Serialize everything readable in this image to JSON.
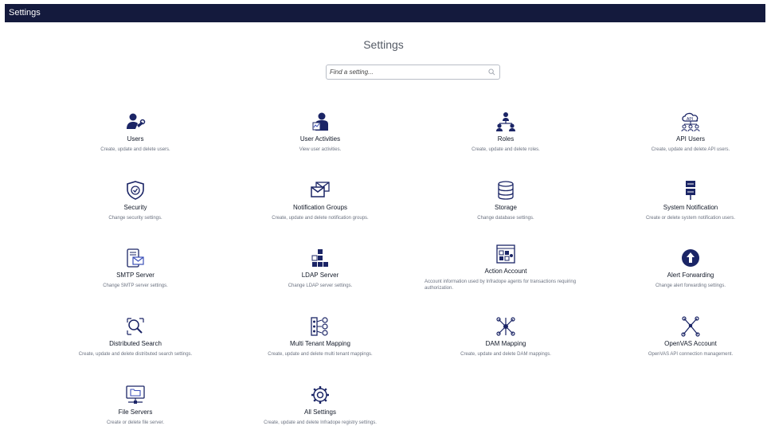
{
  "app": {
    "title": "Settings"
  },
  "page": {
    "heading": "Settings"
  },
  "search": {
    "placeholder": "Find a setting..."
  },
  "colors": {
    "topbar": "#141a3d",
    "icon": "#1b2566",
    "accent": "#3b4fb8"
  },
  "tiles": [
    {
      "id": "users",
      "icon": "user-wrench-icon",
      "name": "Users",
      "desc": "Create, update and delete users."
    },
    {
      "id": "user-activities",
      "icon": "user-activity-icon",
      "name": "User Activities",
      "desc": "View user activities."
    },
    {
      "id": "roles",
      "icon": "roles-hierarchy-icon",
      "name": "Roles",
      "desc": "Create, update and delete roles."
    },
    {
      "id": "api-users",
      "icon": "api-cloud-icon",
      "name": "API Users",
      "desc": "Create, update and delete API users."
    },
    {
      "id": "security",
      "icon": "shield-icon",
      "name": "Security",
      "desc": "Change security settings."
    },
    {
      "id": "notification-groups",
      "icon": "envelope-icon",
      "name": "Notification Groups",
      "desc": "Create, update and delete notification groups."
    },
    {
      "id": "storage",
      "icon": "database-icon",
      "name": "Storage",
      "desc": "Change database settings."
    },
    {
      "id": "system-notification",
      "icon": "system-notification-icon",
      "name": "System Notification",
      "desc": "Create or delete system notification users."
    },
    {
      "id": "smtp-server",
      "icon": "mail-server-icon",
      "name": "SMTP Server",
      "desc": "Change SMTP server settings."
    },
    {
      "id": "ldap-server",
      "icon": "ldap-blocks-icon",
      "name": "LDAP Server",
      "desc": "Change LDAP server settings."
    },
    {
      "id": "action-account",
      "icon": "action-account-icon",
      "name": "Action Account",
      "desc": "Account information used by Infradope agents for transactions requiring authorization."
    },
    {
      "id": "alert-forwarding",
      "icon": "alert-upload-icon",
      "name": "Alert Forwarding",
      "desc": "Change alert forwarding settings."
    },
    {
      "id": "distributed-search",
      "icon": "distributed-search-icon",
      "name": "Distributed Search",
      "desc": "Create, update and delete distributed search settings."
    },
    {
      "id": "multi-tenant-mapping",
      "icon": "tenant-mapping-icon",
      "name": "Multi Tenant Mapping",
      "desc": "Create, update and delete multi tenant mappings."
    },
    {
      "id": "dam-mapping",
      "icon": "dam-network-icon",
      "name": "DAM Mapping",
      "desc": "Create, update and delete DAM mappings."
    },
    {
      "id": "openvas-account",
      "icon": "openvas-network-icon",
      "name": "OpenVAS Account",
      "desc": "OpenVAS API connection management."
    },
    {
      "id": "file-servers",
      "icon": "file-server-icon",
      "name": "File Servers",
      "desc": "Create or delete file server."
    },
    {
      "id": "all-settings",
      "icon": "gear-icon",
      "name": "All Settings",
      "desc": "Create, update and delete Infradope registry settings."
    }
  ]
}
